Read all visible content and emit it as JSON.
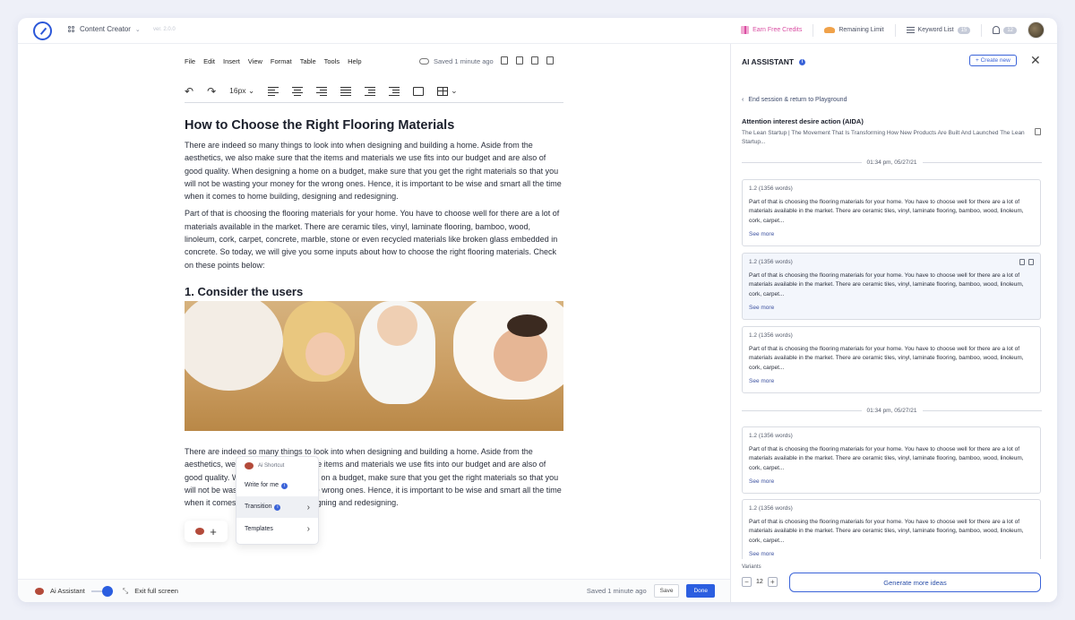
{
  "app": {
    "switcher_label": "Content Creator",
    "version": "ver. 2.0.0"
  },
  "topbar": {
    "earn_credits": "Earn Free Credits",
    "remaining_limit": "Remaining Limit",
    "keyword_list": "Keyword List",
    "keyword_count": "15",
    "notifications_count": "12"
  },
  "menu": [
    "File",
    "Edit",
    "Insert",
    "View",
    "Format",
    "Table",
    "Tools",
    "Help"
  ],
  "editor": {
    "saved_status": "Saved 1 minute ago",
    "font_size": "16px",
    "title": "How to Choose the Right Flooring Materials",
    "para1": "There are indeed so many things to look into when designing and building a home. Aside from the aesthetics, we also make sure that the items and materials we use fits into our budget and are also of good quality. When designing a home on a budget, make sure that you get the right materials so that you will not be wasting your money for the wrong ones. Hence, it is important to be wise and smart all the time when it comes to home building, designing and redesigning.",
    "para2": "Part of that is choosing the flooring materials for your home. You have to choose well for there are a lot of materials available in the market. There are ceramic tiles, vinyl, laminate flooring, bamboo, wood, linoleum, cork, carpet, concrete, marble, stone or even recycled materials like broken glass embedded in concrete. So today, we will give you some inputs about how to choose the right flooring materials. Check on these points below:",
    "heading2": "1. Consider the users",
    "para3": "There are indeed so many things to look into when designing and building a home. Aside from the aesthetics, we also make sure that the items and materials we use fits into our budget and are also of good quality. When designing a home on a budget, make sure that you get the right materials so that you will not be wasting your money for the wrong ones. Hence, it is important to be wise and smart all the time when it comes to home building, designing and redesigning."
  },
  "shortcut": {
    "title": "Ai Shortcut",
    "write": "Write for me",
    "transition": "Transition",
    "templates": "Templates"
  },
  "bottombar": {
    "assistant_label": "Ai Assistant",
    "exit_fullscreen": "Exit full screen",
    "saved_status": "Saved 1 minute ago",
    "save": "Save",
    "done": "Done"
  },
  "panel": {
    "title": "AI ASSISTANT",
    "create_new": "+ Create new",
    "back": "End session & return to Playground",
    "heading": "Attention interest desire action (AIDA)",
    "subtitle": "The Lean Startup | The Movement That Is Transforming How New Products Are Built And Launched The Lean Startup...",
    "timestamp": "01:34 pm, 05/27/21",
    "card_meta": "1.2   (1356 words)",
    "card_text": "Part of that is choosing the flooring materials for your home. You have to choose well for there are a lot of materials available in the market. There are ceramic tiles, vinyl, laminate flooring, bamboo, wood, linoleum, cork, carpet...",
    "see_more": "See more",
    "variants_label": "Variants",
    "variants_value": "12",
    "generate": "Generate more ideas"
  }
}
